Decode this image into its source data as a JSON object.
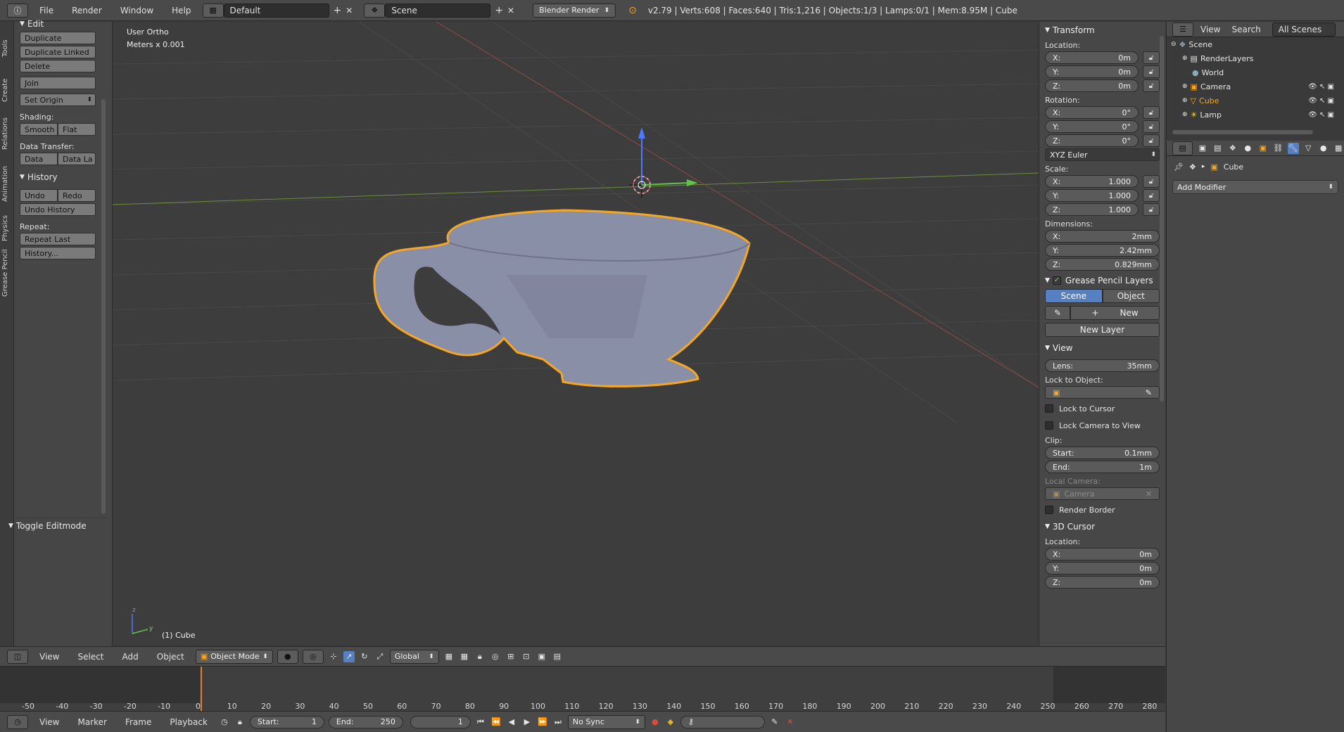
{
  "topbar": {
    "menus": [
      "File",
      "Render",
      "Window",
      "Help"
    ],
    "layout": "Default",
    "scene": "Scene",
    "engine": "Blender Render",
    "stats": "v2.79 | Verts:608 | Faces:640 | Tris:1,216 | Objects:1/3 | Lamps:0/1 | Mem:8.95M | Cube"
  },
  "toolshelf": {
    "tabs": [
      "Tools",
      "Create",
      "Relations",
      "Animation",
      "Physics",
      "Grease Pencil"
    ],
    "edit_header": "Edit",
    "duplicate": "Duplicate",
    "duplicate_linked": "Duplicate Linked",
    "delete": "Delete",
    "join": "Join",
    "set_origin": "Set Origin",
    "shading_label": "Shading:",
    "smooth": "Smooth",
    "flat": "Flat",
    "data_transfer_label": "Data Transfer:",
    "data": "Data",
    "data_la": "Data La",
    "history_header": "History",
    "undo": "Undo",
    "redo": "Redo",
    "undo_history": "Undo History",
    "repeat_label": "Repeat:",
    "repeat_last": "Repeat Last",
    "history_ellipsis": "History...",
    "toggle_editmode": "Toggle Editmode"
  },
  "viewport": {
    "view_name": "User Ortho",
    "units": "Meters x 0.001",
    "active_object": "(1) Cube",
    "axis_z": "z",
    "axis_y": "y",
    "selection_color": "#f5a623",
    "mesh_color": "#8a8fa8"
  },
  "npanel": {
    "transform_header": "Transform",
    "location_label": "Location:",
    "location": [
      {
        "axis": "X:",
        "value": "0m"
      },
      {
        "axis": "Y:",
        "value": "0m"
      },
      {
        "axis": "Z:",
        "value": "0m"
      }
    ],
    "rotation_label": "Rotation:",
    "rotation": [
      {
        "axis": "X:",
        "value": "0°"
      },
      {
        "axis": "Y:",
        "value": "0°"
      },
      {
        "axis": "Z:",
        "value": "0°"
      }
    ],
    "rotation_mode": "XYZ Euler",
    "scale_label": "Scale:",
    "scale": [
      {
        "axis": "X:",
        "value": "1.000"
      },
      {
        "axis": "Y:",
        "value": "1.000"
      },
      {
        "axis": "Z:",
        "value": "1.000"
      }
    ],
    "dimensions_label": "Dimensions:",
    "dimensions": [
      {
        "axis": "X:",
        "value": "2mm"
      },
      {
        "axis": "Y:",
        "value": "2.42mm"
      },
      {
        "axis": "Z:",
        "value": "0.829mm"
      }
    ],
    "grease_header": "Grease Pencil Layers",
    "gp_scene": "Scene",
    "gp_object": "Object",
    "gp_new": "New",
    "gp_new_layer": "New Layer",
    "view_header": "View",
    "lens_label": "Lens:",
    "lens_value": "35mm",
    "lock_to_object": "Lock to Object:",
    "lock_to_cursor": "Lock to Cursor",
    "lock_camera": "Lock Camera to View",
    "clip_label": "Clip:",
    "clip_start_label": "Start:",
    "clip_start": "0.1mm",
    "clip_end_label": "End:",
    "clip_end": "1m",
    "local_camera": "Local Camera:",
    "camera": "Camera",
    "render_border": "Render Border",
    "cursor_header": "3D Cursor",
    "cursor_location_label": "Location:",
    "cursor": [
      {
        "axis": "X:",
        "value": "0m"
      },
      {
        "axis": "Y:",
        "value": "0m"
      },
      {
        "axis": "Z:",
        "value": "0m"
      }
    ]
  },
  "outliner": {
    "view": "View",
    "search": "Search",
    "filter": "All Scenes",
    "items": [
      "Scene",
      "RenderLayers",
      "World",
      "Camera",
      "Cube",
      "Lamp"
    ]
  },
  "properties": {
    "object_name": "Cube",
    "add_modifier": "Add Modifier"
  },
  "vpheader": {
    "menus": [
      "View",
      "Select",
      "Add",
      "Object"
    ],
    "mode": "Object Mode",
    "orientation": "Global"
  },
  "timeline": {
    "ticks": [
      "-50",
      "-40",
      "-30",
      "-20",
      "-10",
      "0",
      "10",
      "20",
      "30",
      "40",
      "50",
      "60",
      "70",
      "80",
      "90",
      "100",
      "110",
      "120",
      "130",
      "140",
      "150",
      "160",
      "170",
      "180",
      "190",
      "200",
      "210",
      "220",
      "230",
      "240",
      "250",
      "260",
      "270",
      "280"
    ],
    "current_frame_color": "#e8802a"
  },
  "tlheader": {
    "menus": [
      "View",
      "Marker",
      "Frame",
      "Playback"
    ],
    "start_label": "Start:",
    "start": "1",
    "end_label": "End:",
    "end": "250",
    "current": "1",
    "sync": "No Sync"
  }
}
